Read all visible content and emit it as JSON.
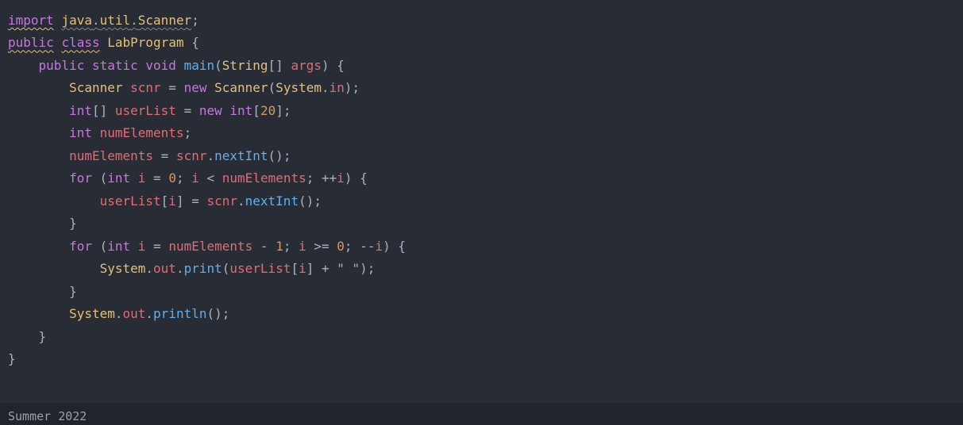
{
  "code": {
    "lines": [
      {
        "indent": 0,
        "tokens": [
          {
            "t": "import",
            "c": "k",
            "wavy": "y"
          },
          {
            "t": " ",
            "c": "op"
          },
          {
            "t": "java",
            "c": "ty",
            "wavy": "g"
          },
          {
            "t": ".",
            "c": "op",
            "wavy": "g"
          },
          {
            "t": "util",
            "c": "ty",
            "wavy": "g"
          },
          {
            "t": ".",
            "c": "op",
            "wavy": "g"
          },
          {
            "t": "Scanner",
            "c": "ty",
            "wavy": "g"
          },
          {
            "t": ";",
            "c": "op"
          }
        ]
      },
      {
        "indent": 0,
        "tokens": [
          {
            "t": "public",
            "c": "k",
            "wavy": "y"
          },
          {
            "t": " ",
            "c": "op"
          },
          {
            "t": "class",
            "c": "k",
            "wavy": "y"
          },
          {
            "t": " ",
            "c": "op"
          },
          {
            "t": "LabProgram",
            "c": "ty"
          },
          {
            "t": " {",
            "c": "op"
          }
        ]
      },
      {
        "indent": 1,
        "tokens": [
          {
            "t": "public",
            "c": "k"
          },
          {
            "t": " ",
            "c": "op"
          },
          {
            "t": "static",
            "c": "k"
          },
          {
            "t": " ",
            "c": "op"
          },
          {
            "t": "void",
            "c": "k"
          },
          {
            "t": " ",
            "c": "op"
          },
          {
            "t": "main",
            "c": "fn"
          },
          {
            "t": "(",
            "c": "op"
          },
          {
            "t": "String",
            "c": "ty"
          },
          {
            "t": "[] ",
            "c": "op"
          },
          {
            "t": "args",
            "c": "id"
          },
          {
            "t": ") {",
            "c": "op"
          }
        ]
      },
      {
        "indent": 2,
        "tokens": [
          {
            "t": "Scanner",
            "c": "ty"
          },
          {
            "t": " ",
            "c": "op"
          },
          {
            "t": "scnr",
            "c": "id"
          },
          {
            "t": " = ",
            "c": "op"
          },
          {
            "t": "new",
            "c": "k"
          },
          {
            "t": " ",
            "c": "op"
          },
          {
            "t": "Scanner",
            "c": "ty"
          },
          {
            "t": "(",
            "c": "op"
          },
          {
            "t": "System",
            "c": "ty"
          },
          {
            "t": ".",
            "c": "op"
          },
          {
            "t": "in",
            "c": "id"
          },
          {
            "t": ");",
            "c": "op"
          }
        ]
      },
      {
        "indent": 2,
        "tokens": [
          {
            "t": "int",
            "c": "kw-int"
          },
          {
            "t": "[] ",
            "c": "op"
          },
          {
            "t": "userList",
            "c": "id"
          },
          {
            "t": " = ",
            "c": "op"
          },
          {
            "t": "new",
            "c": "k"
          },
          {
            "t": " ",
            "c": "op"
          },
          {
            "t": "int",
            "c": "kw-int"
          },
          {
            "t": "[",
            "c": "op"
          },
          {
            "t": "20",
            "c": "num"
          },
          {
            "t": "];",
            "c": "op"
          }
        ]
      },
      {
        "indent": 2,
        "tokens": [
          {
            "t": "int",
            "c": "kw-int"
          },
          {
            "t": " ",
            "c": "op"
          },
          {
            "t": "numElements",
            "c": "id"
          },
          {
            "t": ";",
            "c": "op"
          }
        ]
      },
      {
        "indent": 2,
        "tokens": [
          {
            "t": "numElements",
            "c": "id"
          },
          {
            "t": " = ",
            "c": "op"
          },
          {
            "t": "scnr",
            "c": "id"
          },
          {
            "t": ".",
            "c": "op"
          },
          {
            "t": "nextInt",
            "c": "fn"
          },
          {
            "t": "();",
            "c": "op"
          }
        ]
      },
      {
        "indent": 2,
        "tokens": [
          {
            "t": "for",
            "c": "k"
          },
          {
            "t": " (",
            "c": "op"
          },
          {
            "t": "int",
            "c": "kw-int"
          },
          {
            "t": " ",
            "c": "op"
          },
          {
            "t": "i",
            "c": "id"
          },
          {
            "t": " = ",
            "c": "op"
          },
          {
            "t": "0",
            "c": "num"
          },
          {
            "t": "; ",
            "c": "op"
          },
          {
            "t": "i",
            "c": "id"
          },
          {
            "t": " < ",
            "c": "op"
          },
          {
            "t": "numElements",
            "c": "id"
          },
          {
            "t": "; ++",
            "c": "op"
          },
          {
            "t": "i",
            "c": "id"
          },
          {
            "t": ") {",
            "c": "op"
          }
        ]
      },
      {
        "indent": 3,
        "tokens": [
          {
            "t": "userList",
            "c": "id"
          },
          {
            "t": "[",
            "c": "op"
          },
          {
            "t": "i",
            "c": "id"
          },
          {
            "t": "] = ",
            "c": "op"
          },
          {
            "t": "scnr",
            "c": "id"
          },
          {
            "t": ".",
            "c": "op"
          },
          {
            "t": "nextInt",
            "c": "fn"
          },
          {
            "t": "();",
            "c": "op"
          }
        ]
      },
      {
        "indent": 2,
        "tokens": [
          {
            "t": "}",
            "c": "op"
          }
        ]
      },
      {
        "indent": 2,
        "tokens": [
          {
            "t": "for",
            "c": "k"
          },
          {
            "t": " (",
            "c": "op"
          },
          {
            "t": "int",
            "c": "kw-int"
          },
          {
            "t": " ",
            "c": "op"
          },
          {
            "t": "i",
            "c": "id"
          },
          {
            "t": " = ",
            "c": "op"
          },
          {
            "t": "numElements",
            "c": "id"
          },
          {
            "t": " - ",
            "c": "op"
          },
          {
            "t": "1",
            "c": "num"
          },
          {
            "t": "; ",
            "c": "op"
          },
          {
            "t": "i",
            "c": "id"
          },
          {
            "t": " >= ",
            "c": "op"
          },
          {
            "t": "0",
            "c": "num"
          },
          {
            "t": "; --",
            "c": "op"
          },
          {
            "t": "i",
            "c": "id"
          },
          {
            "t": ") {",
            "c": "op"
          }
        ]
      },
      {
        "indent": 3,
        "tokens": [
          {
            "t": "System",
            "c": "ty"
          },
          {
            "t": ".",
            "c": "op"
          },
          {
            "t": "out",
            "c": "id"
          },
          {
            "t": ".",
            "c": "op"
          },
          {
            "t": "print",
            "c": "fn"
          },
          {
            "t": "(",
            "c": "op"
          },
          {
            "t": "userList",
            "c": "id"
          },
          {
            "t": "[",
            "c": "op"
          },
          {
            "t": "i",
            "c": "id"
          },
          {
            "t": "] + ",
            "c": "op"
          },
          {
            "t": "\" \"",
            "c": "str"
          },
          {
            "t": ");",
            "c": "op"
          }
        ]
      },
      {
        "indent": 2,
        "tokens": [
          {
            "t": "}",
            "c": "op"
          }
        ]
      },
      {
        "indent": 2,
        "tokens": [
          {
            "t": "System",
            "c": "ty"
          },
          {
            "t": ".",
            "c": "op"
          },
          {
            "t": "out",
            "c": "id"
          },
          {
            "t": ".",
            "c": "op"
          },
          {
            "t": "println",
            "c": "fn"
          },
          {
            "t": "();",
            "c": "op"
          }
        ]
      },
      {
        "indent": 1,
        "tokens": [
          {
            "t": "}",
            "c": "op"
          }
        ]
      },
      {
        "indent": 0,
        "tokens": [
          {
            "t": "}",
            "c": "op"
          }
        ]
      }
    ]
  },
  "status": {
    "left": "Summer 2022"
  }
}
